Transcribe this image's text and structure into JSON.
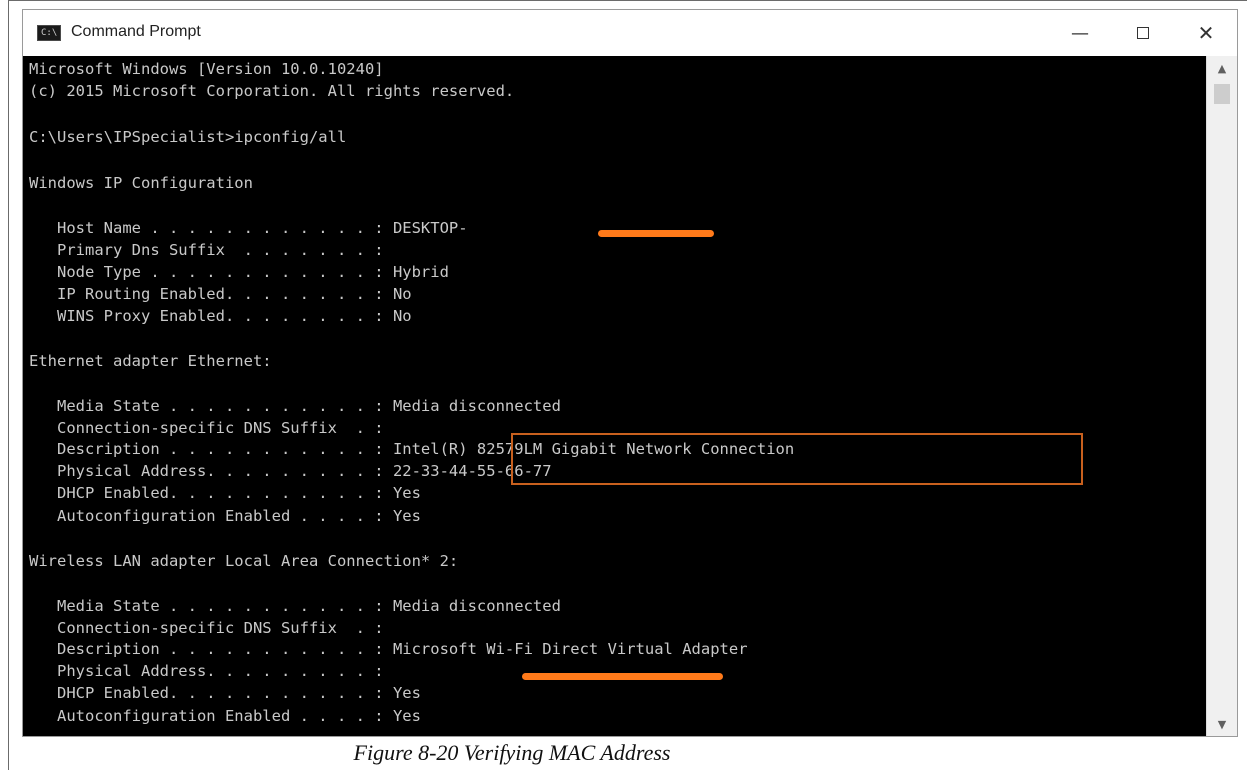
{
  "window": {
    "title": "Command Prompt",
    "icon": "cmd-icon",
    "controls": {
      "minimize": "—",
      "close": "✕"
    }
  },
  "console": {
    "lines": [
      "Microsoft Windows [Version 10.0.10240]",
      "(c) 2015 Microsoft Corporation. All rights reserved.",
      "",
      "C:\\Users\\IPSpecialist>ipconfig/all",
      "",
      "Windows IP Configuration",
      "",
      "   Host Name . . . . . . . . . . . . : DESKTOP-",
      "   Primary Dns Suffix  . . . . . . . :",
      "   Node Type . . . . . . . . . . . . : Hybrid",
      "   IP Routing Enabled. . . . . . . . : No",
      "   WINS Proxy Enabled. . . . . . . . : No",
      "",
      "Ethernet adapter Ethernet:",
      "",
      "   Media State . . . . . . . . . . . : Media disconnected",
      "   Connection-specific DNS Suffix  . :",
      "   Description . . . . . . . . . . . : Intel(R) 82579LM Gigabit Network Connection",
      "   Physical Address. . . . . . . . . : 22-33-44-55-66-77",
      "   DHCP Enabled. . . . . . . . . . . : Yes",
      "   Autoconfiguration Enabled . . . . : Yes",
      "",
      "Wireless LAN adapter Local Area Connection* 2:",
      "",
      "   Media State . . . . . . . . . . . : Media disconnected",
      "   Connection-specific DNS Suffix  . :",
      "   Description . . . . . . . . . . . : Microsoft Wi-Fi Direct Virtual Adapter",
      "   Physical Address. . . . . . . . . :",
      "   DHCP Enabled. . . . . . . . . . . : Yes",
      "   Autoconfiguration Enabled . . . . : Yes"
    ]
  },
  "colors": {
    "console_bg": "#000000",
    "console_text": "#c9c9c9",
    "highlight_border": "#c8601e",
    "redaction": "#ff7a1a"
  },
  "scrollbar": {
    "up": "▲",
    "down": "▼"
  },
  "caption": "Figure 8-20 Verifying MAC Address"
}
